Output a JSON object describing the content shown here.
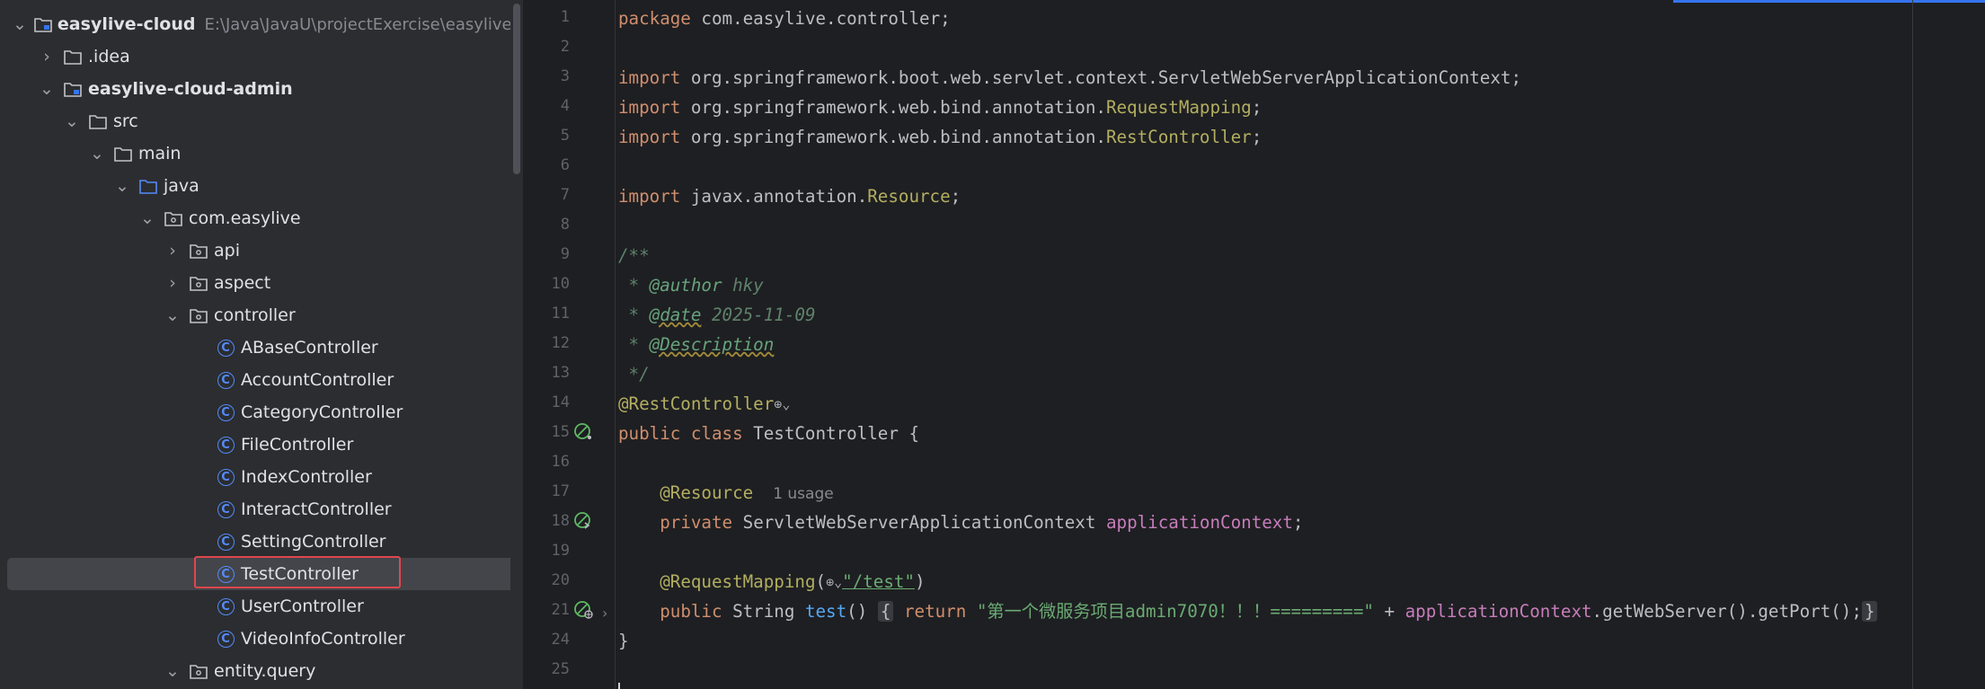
{
  "tree": {
    "root": {
      "name": "easylive-cloud",
      "path": "E:\\Java\\JavaU\\projectExercise\\easylive\\easyli"
    },
    "idea": ".idea",
    "module": "easylive-cloud-admin",
    "src": "src",
    "main": "main",
    "java": "java",
    "package": "com.easylive",
    "api": "api",
    "aspect": "aspect",
    "controller": "controller",
    "classes": [
      "ABaseController",
      "AccountController",
      "CategoryController",
      "FileController",
      "IndexController",
      "InteractController",
      "SettingController",
      "TestController",
      "UserController",
      "VideoInfoController"
    ],
    "entity_query": "entity.query",
    "class_badge": "C",
    "selected": "TestController"
  },
  "editor": {
    "line_numbers": [
      "1",
      "2",
      "3",
      "4",
      "5",
      "6",
      "7",
      "8",
      "9",
      "10",
      "11",
      "12",
      "13",
      "14",
      "15",
      "16",
      "17",
      "18",
      "19",
      "20",
      "21",
      "24",
      "25"
    ],
    "l1_kw": "package",
    "l1_rest": " com.easylive.controller;",
    "import_kw": "import",
    "l3_rest": " org.springframework.boot.web.servlet.context.ServletWebServerApplicationContext;",
    "l4_pre": " org.springframework.web.bind.annotation.",
    "l4_cls": "RequestMapping",
    "l5_pre": " org.springframework.web.bind.annotation.",
    "l5_cls": "RestController",
    "l7_pre": " javax.annotation.",
    "l7_cls": "Resource",
    "semi": ";",
    "l9": "/**",
    "doc_star": " * ",
    "l10_tag": "@author",
    "l10_val": " hky",
    "l11_tag": "@date",
    "l11_val": " 2025-11-09",
    "l12_tag": "@Description",
    "l13": " */",
    "l14_ann": "@RestController",
    "l15_kw": "public class",
    "l15_rest": " TestController {",
    "l17_indent": "    ",
    "l17_ann": "@Resource",
    "l17_hint": "1 usage",
    "l18_kw": "private",
    "l18_type": " ServletWebServerApplicationContext ",
    "l18_fld": "applicationContext",
    "l20_ann": "@RequestMapping",
    "paren_open": "(",
    "paren_close": ")",
    "l20_str": "\"/test\"",
    "l21_kw": "public",
    "l21_type": " String ",
    "l21_fn": "test",
    "l21_parens": "()",
    "brace_open": "{",
    "l21_ret": "return",
    "l21_str": "\"第一个微服务项目admin7070！！！=========\"",
    "l21_plus": " + ",
    "l21_fld": "applicationContext",
    "l21_tail": ".getWebServer().getPort();",
    "brace_close": "}",
    "l24": "}",
    "globe_glyph": "⊕",
    "chevron_glyph": "⌄",
    "fold_arrow": "›"
  },
  "colors": {
    "keyword": "#cf8e6d",
    "annotation": "#b3ae60",
    "string": "#6aab73",
    "field": "#c77dbb",
    "method": "#56a8f5",
    "class_icon": "#548af7",
    "selection_box": "#e0464e"
  }
}
